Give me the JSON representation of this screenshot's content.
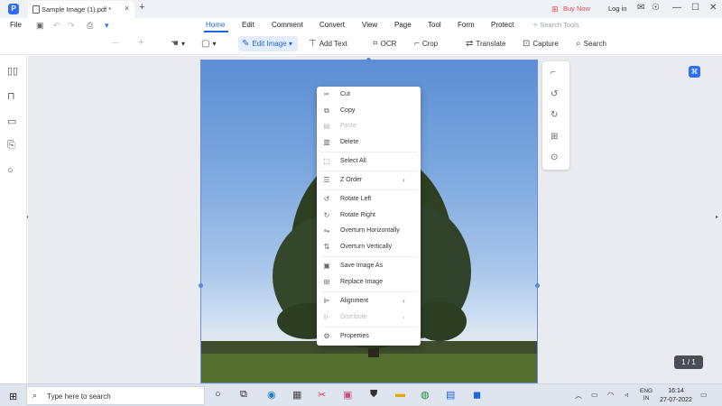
{
  "window": {
    "tab_title": "Sample Image (1).pdf *",
    "tab_close": "×",
    "new_tab": "+",
    "buy_now": "Buy Now",
    "log_in": "Log in",
    "minimize": "—",
    "maximize": "☐",
    "close": "✕"
  },
  "menu": {
    "file": "File",
    "items": [
      "Home",
      "Edit",
      "Comment",
      "Convert",
      "View",
      "Page",
      "Tool",
      "Form",
      "Protect"
    ],
    "active": "Home",
    "search_tools": "Search Tools"
  },
  "toolbar": {
    "zoom_out": "—",
    "zoom_in": "+",
    "edit_image": "Edit Image",
    "add_text": "Add Text",
    "ocr": "OCR",
    "crop": "Crop",
    "translate": "Translate",
    "capture": "Capture",
    "search": "Search"
  },
  "context_menu": {
    "items": [
      {
        "label": "Cut",
        "icon": "scissors-icon",
        "enabled": true
      },
      {
        "label": "Copy",
        "icon": "copy-icon",
        "enabled": true
      },
      {
        "label": "Paste",
        "icon": "paste-icon",
        "enabled": false
      },
      {
        "label": "Delete",
        "icon": "trash-icon",
        "enabled": true
      },
      {
        "label": "Select All",
        "icon": "select-all-icon",
        "enabled": true
      },
      {
        "label": "Z Order",
        "icon": "z-order-icon",
        "enabled": true,
        "submenu": true
      },
      {
        "label": "Rotate Left",
        "icon": "rotate-left-icon",
        "enabled": true
      },
      {
        "label": "Rotate Right",
        "icon": "rotate-right-icon",
        "enabled": true
      },
      {
        "label": "Overturn Horizontally",
        "icon": "flip-horizontal-icon",
        "enabled": true
      },
      {
        "label": "Overturn Vertically",
        "icon": "flip-vertical-icon",
        "enabled": true
      },
      {
        "label": "Save Image As",
        "icon": "save-image-icon",
        "enabled": true
      },
      {
        "label": "Replace Image",
        "icon": "replace-image-icon",
        "enabled": true
      },
      {
        "label": "Alignment",
        "icon": "alignment-icon",
        "enabled": true,
        "submenu": true
      },
      {
        "label": "Distribute",
        "icon": "distribute-icon",
        "enabled": false,
        "submenu": true
      },
      {
        "label": "Properties",
        "icon": "properties-icon",
        "enabled": true
      }
    ]
  },
  "page_indicator": "1 / 1",
  "taskbar": {
    "search_placeholder": "Type here to search",
    "lang_top": "ENG",
    "lang_bottom": "IN",
    "time": "16:14",
    "date": "27-07-2022"
  },
  "colors": {
    "accent": "#1f66e5",
    "brand": "#2f6df6",
    "buy_now": "#e5484d"
  }
}
